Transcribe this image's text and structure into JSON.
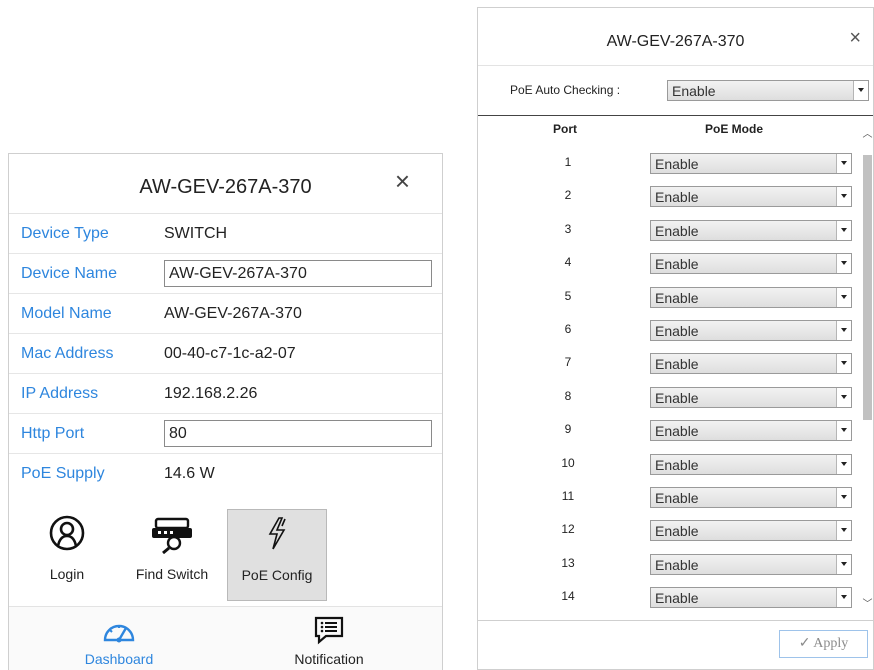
{
  "left_panel": {
    "title": "AW-GEV-267A-370",
    "close": "×",
    "rows": {
      "device_type": {
        "label": "Device Type",
        "value": "SWITCH"
      },
      "device_name": {
        "label": "Device Name",
        "value": "AW-GEV-267A-370"
      },
      "model_name": {
        "label": "Model Name",
        "value": "AW-GEV-267A-370"
      },
      "mac_address": {
        "label": "Mac Address",
        "value": "00-40-c7-1c-a2-07"
      },
      "ip_address": {
        "label": "IP Address",
        "value": "192.168.2.26"
      },
      "http_port": {
        "label": "Http Port",
        "value": "80"
      },
      "poe_supply": {
        "label": "PoE Supply",
        "value": "14.6 W"
      }
    },
    "tools": {
      "login": "Login",
      "find_switch": "Find Switch",
      "poe_config": "PoE Config"
    },
    "bottom_nav": {
      "dashboard": "Dashboard",
      "notification": "Notification"
    },
    "colors": {
      "label_blue": "#2e86de",
      "dashboard_blue": "#2e86de",
      "active_tool_bg": "#e0e0e0"
    }
  },
  "right_panel": {
    "title": "AW-GEV-267A-370",
    "close": "×",
    "poe_auto": {
      "label": "PoE Auto Checking :",
      "value": "Enable"
    },
    "headers": {
      "port": "Port",
      "mode": "PoE Mode"
    },
    "ports": [
      {
        "port": "1",
        "mode": "Enable"
      },
      {
        "port": "2",
        "mode": "Enable"
      },
      {
        "port": "3",
        "mode": "Enable"
      },
      {
        "port": "4",
        "mode": "Enable"
      },
      {
        "port": "5",
        "mode": "Enable"
      },
      {
        "port": "6",
        "mode": "Enable"
      },
      {
        "port": "7",
        "mode": "Enable"
      },
      {
        "port": "8",
        "mode": "Enable"
      },
      {
        "port": "9",
        "mode": "Enable"
      },
      {
        "port": "10",
        "mode": "Enable"
      },
      {
        "port": "11",
        "mode": "Enable"
      },
      {
        "port": "12",
        "mode": "Enable"
      },
      {
        "port": "13",
        "mode": "Enable"
      },
      {
        "port": "14",
        "mode": "Enable"
      }
    ],
    "apply": "✓  Apply"
  }
}
